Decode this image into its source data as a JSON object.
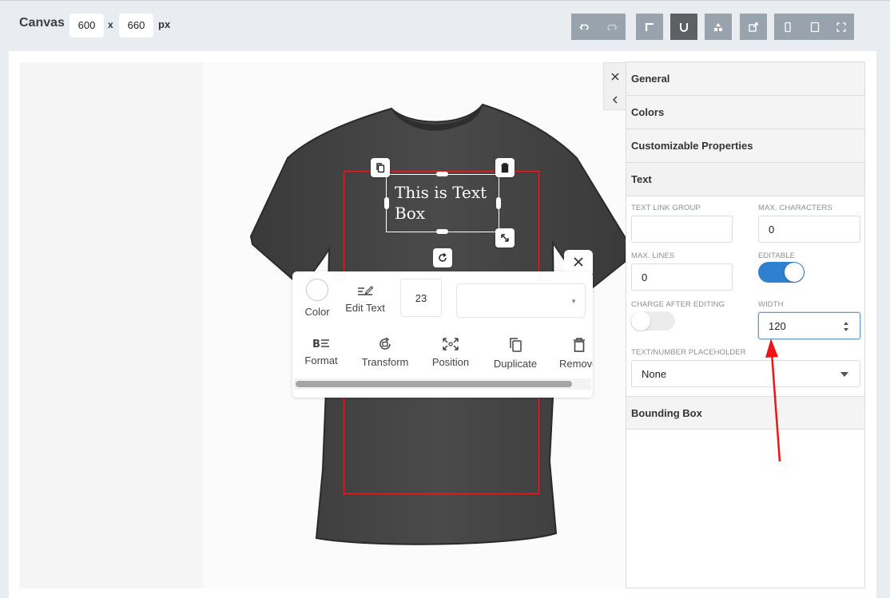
{
  "canvas": {
    "label": "Canvas",
    "width": "600",
    "height": "660",
    "sep": "x",
    "unit": "px"
  },
  "toolbar": {
    "buttons": [
      {
        "name": "undo-button",
        "icon": "undo-icon"
      },
      {
        "name": "redo-button",
        "icon": "redo-icon",
        "disabled": true
      },
      {
        "name": "snap-button",
        "icon": "corner-icon"
      },
      {
        "name": "magnet-button",
        "icon": "magnet-icon",
        "active": true
      },
      {
        "name": "shapes-button",
        "icon": "shapes-icon"
      },
      {
        "name": "export-button",
        "icon": "export-icon"
      },
      {
        "name": "mobile-view-button",
        "icon": "phone-icon"
      },
      {
        "name": "tablet-view-button",
        "icon": "tablet-icon"
      },
      {
        "name": "fullscreen-button",
        "icon": "fullscreen-icon"
      }
    ],
    "colors": {
      "button": "#98a3ad",
      "active": "#5e6063"
    }
  },
  "design": {
    "text_line1": "This is Text",
    "text_line2": "Box",
    "shirt_color": "#444444",
    "print_area_color": "#e2262b"
  },
  "float_toolbar": {
    "color_label": "Color",
    "edit_text_label": "Edit Text",
    "font_size": "23",
    "font_family": "",
    "format_label": "Format",
    "transform_label": "Transform",
    "position_label": "Position",
    "duplicate_label": "Duplicate",
    "remove_label": "Remove"
  },
  "panel": {
    "sections": {
      "general": "General",
      "colors": "Colors",
      "customizable": "Customizable Properties",
      "text": "Text",
      "bounding_box": "Bounding Box"
    },
    "fields": {
      "text_link_group_label": "TEXT LINK GROUP",
      "text_link_group_value": "",
      "max_characters_label": "MAX. CHARACTERS",
      "max_characters_value": "0",
      "max_lines_label": "MAX. LINES",
      "max_lines_value": "0",
      "editable_label": "EDITABLE",
      "editable_on": true,
      "charge_after_editing_label": "CHARGE AFTER EDITING",
      "charge_after_editing_on": false,
      "width_label": "WIDTH",
      "width_value": "120",
      "placeholder_label": "TEXT/NUMBER PLACEHOLDER",
      "placeholder_value": "None"
    },
    "toggle_on_color": "#2f80d1"
  },
  "annotation": {
    "arrow_color": "#f01515"
  }
}
